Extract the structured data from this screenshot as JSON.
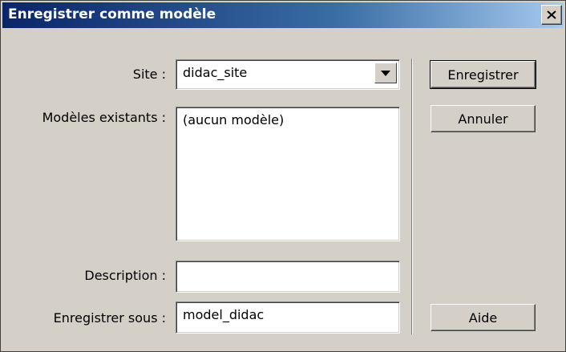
{
  "window": {
    "title": "Enregistrer comme modèle",
    "close_icon": "close-icon"
  },
  "form": {
    "site_label": "Site :",
    "site_value": "didac_site",
    "existing_label": "Modèles existants :",
    "existing_items": [
      "(aucun modèle)"
    ],
    "description_label": "Description :",
    "description_value": "",
    "save_as_label": "Enregistrer sous :",
    "save_as_value": "model_didac"
  },
  "buttons": {
    "save": "Enregistrer",
    "cancel": "Annuler",
    "help": "Aide"
  },
  "colors": {
    "dialog_bg": "#d4d0c8",
    "title_start": "#0a246a",
    "title_end": "#a6caf0"
  }
}
